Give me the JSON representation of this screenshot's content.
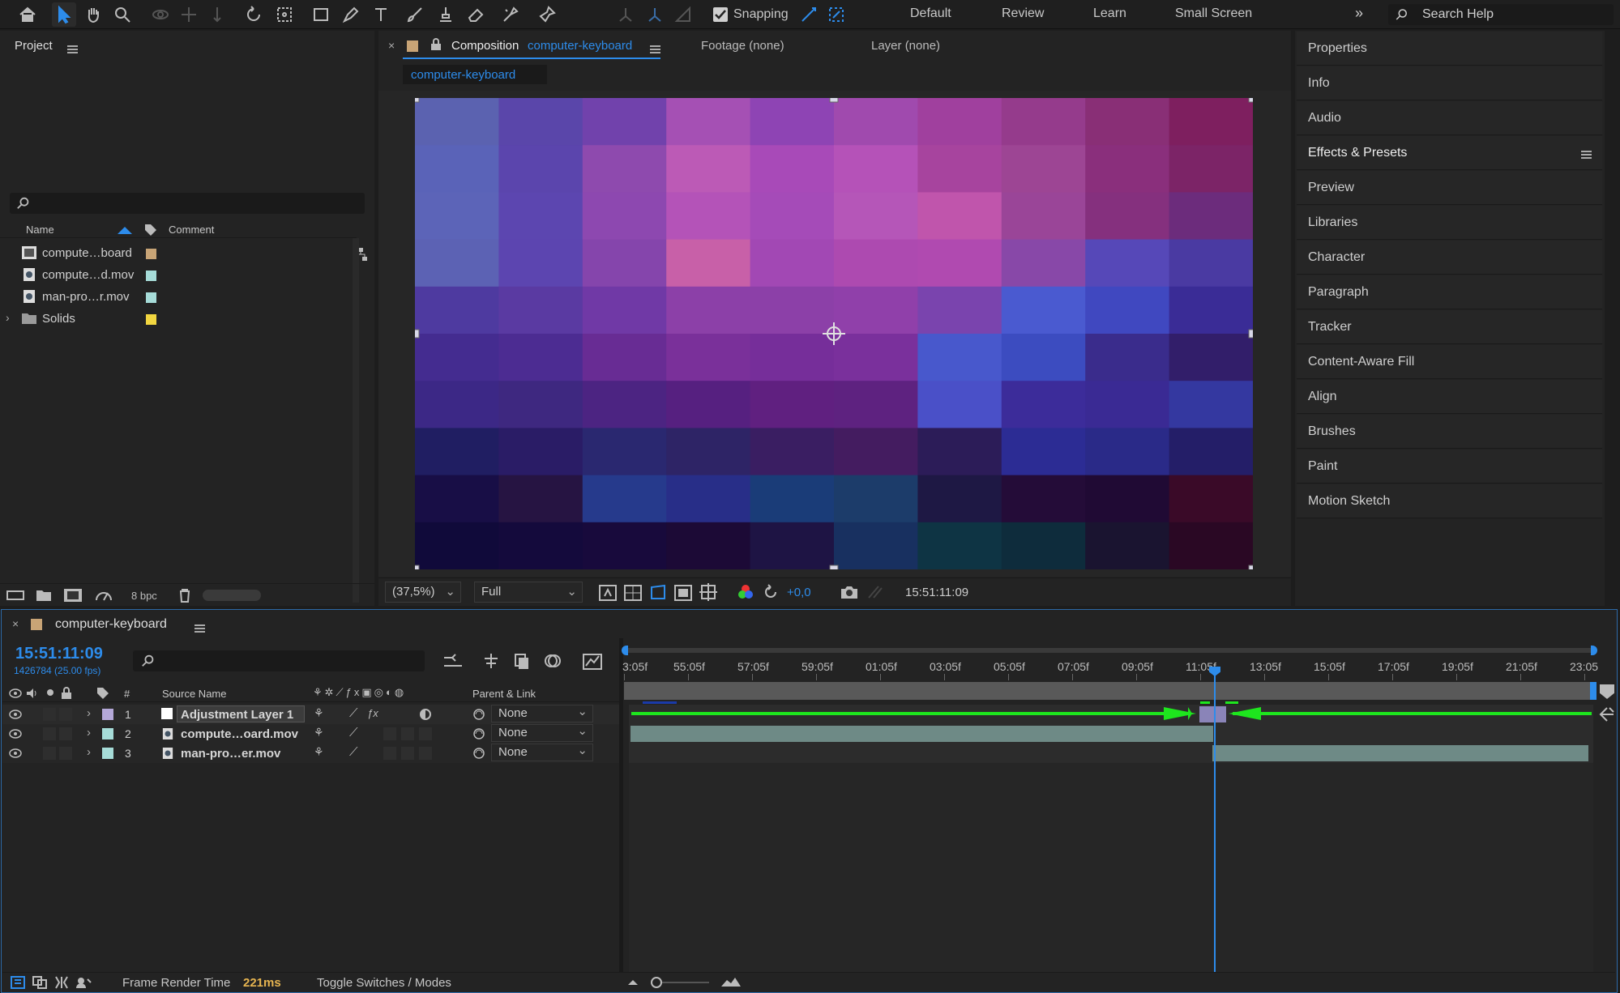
{
  "toolbar": {
    "snapping_label": "Snapping",
    "workspaces": [
      "Default",
      "Review",
      "Learn",
      "Small Screen"
    ],
    "search_placeholder": "Search Help"
  },
  "project": {
    "title": "Project",
    "col_name": "Name",
    "col_comment": "Comment",
    "items": [
      {
        "name": "compute…board",
        "icon": "composition-icon",
        "color": "#c8a476"
      },
      {
        "name": "compute…d.mov",
        "icon": "footage-icon",
        "color": "#a6dcd8"
      },
      {
        "name": "man-pro…r.mov",
        "icon": "footage-icon",
        "color": "#a6dcd8"
      },
      {
        "name": "Solids",
        "icon": "folder-icon",
        "color": "#f2d640"
      }
    ],
    "bpc": "8 bpc"
  },
  "composition": {
    "tab_prefix": "Composition",
    "tab_name": "computer-keyboard",
    "footage_tab": "Footage (none)",
    "layer_tab": "Layer (none)",
    "breadcrumb": "computer-keyboard",
    "zoom": "(37,5%)",
    "resolution": "Full",
    "exposure": "+0,0",
    "timecode": "15:51:11:09"
  },
  "right_panels": [
    "Properties",
    "Info",
    "Audio",
    "Effects & Presets",
    "Preview",
    "Libraries",
    "Character",
    "Paragraph",
    "Tracker",
    "Content-Aware Fill",
    "Align",
    "Brushes",
    "Paint",
    "Motion Sketch"
  ],
  "timeline": {
    "comp_name": "computer-keyboard",
    "timecode": "15:51:11:09",
    "frame_info": "1426784 (25.00 fps)",
    "col_hash": "#",
    "col_source": "Source Name",
    "col_parent": "Parent & Link",
    "layers": [
      {
        "num": "1",
        "name": "Adjustment Layer 1",
        "color": "#b4a8d8",
        "parent": "None"
      },
      {
        "num": "2",
        "name": "compute…oard.mov",
        "color": "#a6dcd8",
        "parent": "None"
      },
      {
        "num": "3",
        "name": "man-pro…er.mov",
        "color": "#a6dcd8",
        "parent": "None"
      }
    ],
    "ruler": [
      "3:05f",
      "55:05f",
      "57:05f",
      "59:05f",
      "01:05f",
      "03:05f",
      "05:05f",
      "07:05f",
      "09:05f",
      "11:05f",
      "13:05f",
      "15:05f",
      "17:05f",
      "19:05f",
      "21:05f",
      "23:05"
    ],
    "frame_render_label": "Frame Render Time",
    "frame_render_value": "221ms",
    "toggle_label": "Toggle Switches / Modes"
  },
  "colors": {
    "accent": "#2d8ceb",
    "arrow": "#1ee61e",
    "layer_bar": "#6e8a86",
    "adj_bar": "#8a84b8"
  },
  "canvas_grid": [
    [
      "#5b62b0",
      "#5a46aa",
      "#7142ac",
      "#a550b4",
      "#8e44b4",
      "#a04aae",
      "#a0409e",
      "#953b8c",
      "#892f76",
      "#7e1f5f"
    ],
    [
      "#5a63b8",
      "#5b45ad",
      "#8e4aae",
      "#bc5ab6",
      "#a84ab8",
      "#b552b8",
      "#a7449e",
      "#9d4594",
      "#8a2f7c",
      "#7c2467"
    ],
    [
      "#5c64b8",
      "#5c46b0",
      "#8d48b0",
      "#b453b8",
      "#a54bb8",
      "#b556b8",
      "#c055ac",
      "#9a4598",
      "#85307e",
      "#6c2c7c"
    ],
    [
      "#5c62b4",
      "#5c45b0",
      "#8545ac",
      "#c860a8",
      "#a248b4",
      "#ad4ab0",
      "#b04ab0",
      "#8848a8",
      "#5648b8",
      "#4a3aa2"
    ],
    [
      "#4e3aa0",
      "#5a3aa2",
      "#7039a6",
      "#8c40a8",
      "#8c40a8",
      "#9040aa",
      "#7a44ae",
      "#4a5ad0",
      "#4048c0",
      "#3a2c96"
    ],
    [
      "#442c90",
      "#4c2c92",
      "#682c94",
      "#7a309a",
      "#762e9a",
      "#7a309c",
      "#4858cc",
      "#3c4cc0",
      "#3a2c8c",
      "#321e6a"
    ],
    [
      "#3c2886",
      "#3e2880",
      "#4c2482",
      "#562080",
      "#602080",
      "#5e2280",
      "#4a50c8",
      "#3c2c9a",
      "#3a2a94",
      "#3438a0"
    ],
    [
      "#201e62",
      "#2a1c66",
      "#2a2870",
      "#2e2466",
      "#3a1e62",
      "#441c60",
      "#2c1c58",
      "#2c2c94",
      "#2a2a88",
      "#241e68"
    ],
    [
      "#180e46",
      "#261442",
      "#263a8c",
      "#282e88",
      "#1a3c78",
      "#1c3c6a",
      "#1e1844",
      "#240c38",
      "#200a34",
      "#3a0a28"
    ],
    [
      "#100a3a",
      "#140a3c",
      "#180a3c",
      "#1c0a36",
      "#1e1444",
      "#183060",
      "#0e3444",
      "#0e2c3c",
      "#1a1430",
      "#2a0824"
    ]
  ]
}
